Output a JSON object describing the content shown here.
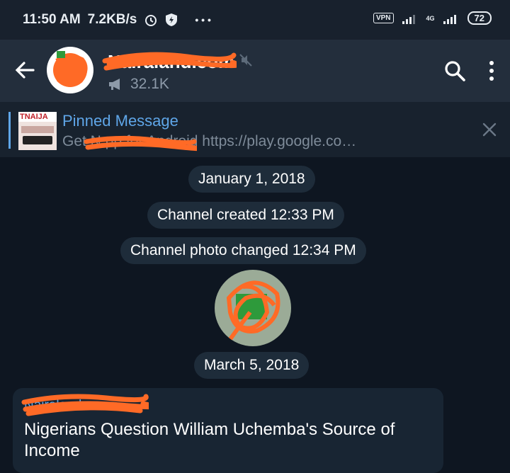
{
  "status_bar": {
    "time": "11:50 AM",
    "speed": "7.2KB/s",
    "more": "• • •",
    "vpn": "VPN",
    "network": "4G",
    "battery": "72"
  },
  "header": {
    "title": "Nairaland.com",
    "subscribers": "32.1K",
    "icons": [
      "back-arrow-icon",
      "megaphone-icon",
      "mute-icon",
      "search-icon",
      "more-vert-icon"
    ]
  },
  "pinned": {
    "title": "Pinned Message",
    "text": "Get N           pp for Android  https://play.google.co…",
    "thumb_text": "TNAIJA"
  },
  "timeline": {
    "date1": "January 1, 2018",
    "event1": "Channel created  12:33 PM",
    "event2": "Channel photo changed  12:34 PM",
    "date2": "March 5, 2018"
  },
  "message": {
    "author": "Nairaland.com",
    "body": "Nigerians Question William Uchemba's Source of Income"
  },
  "colors": {
    "background": "#0e1621",
    "header": "#232e3c",
    "accent": "#5fa6e8",
    "redaction": "#ff6a26"
  }
}
